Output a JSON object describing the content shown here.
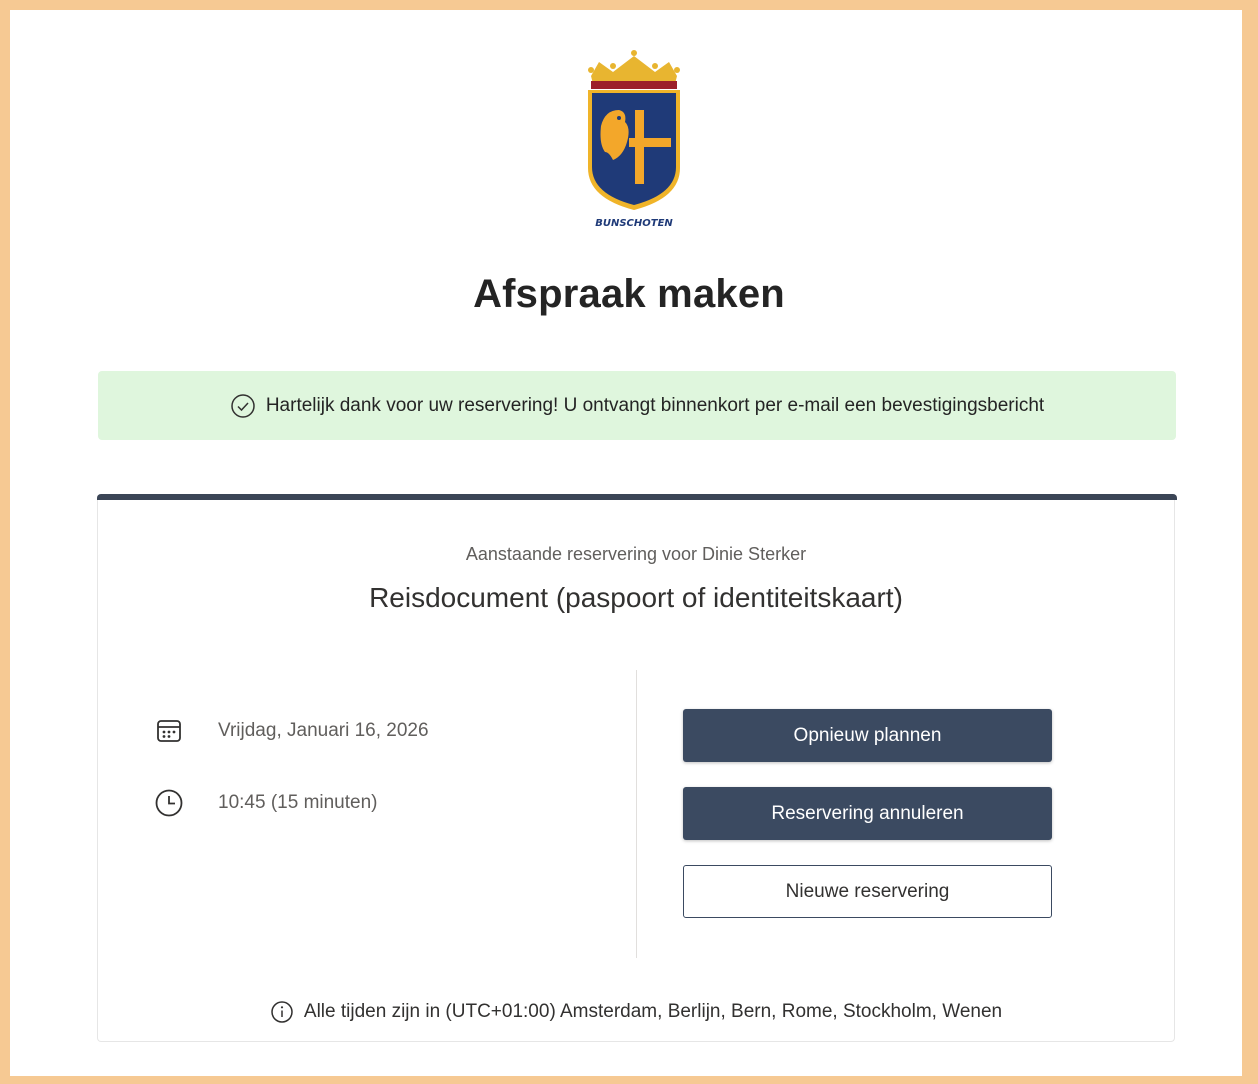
{
  "page": {
    "title": "Afspraak maken"
  },
  "logo": {
    "icon": "bunschoten-coat-of-arms",
    "text": "BUNSCHOTEN"
  },
  "banner": {
    "icon": "check-circle-icon",
    "message": "Hartelijk dank voor uw reservering! U ontvangt binnenkort per e-mail een bevestigingsbericht",
    "color": "#dff6dd"
  },
  "booking": {
    "subtitle": "Aanstaande reservering voor Dinie Sterker",
    "service": "Reisdocument (paspoort of identiteitskaart)",
    "date": "Vrijdag, Januari 16, 2026",
    "time": "10:45 (15 minuten)",
    "accent": "#3b4556"
  },
  "actions": {
    "reschedule": "Opnieuw plannen",
    "cancel": "Reservering annuleren",
    "new": "Nieuwe reservering"
  },
  "footer": {
    "icon": "info-icon",
    "timezone": "Alle tijden zijn in (UTC+01:00) Amsterdam, Berlijn, Bern, Rome, Stockholm, Wenen"
  }
}
